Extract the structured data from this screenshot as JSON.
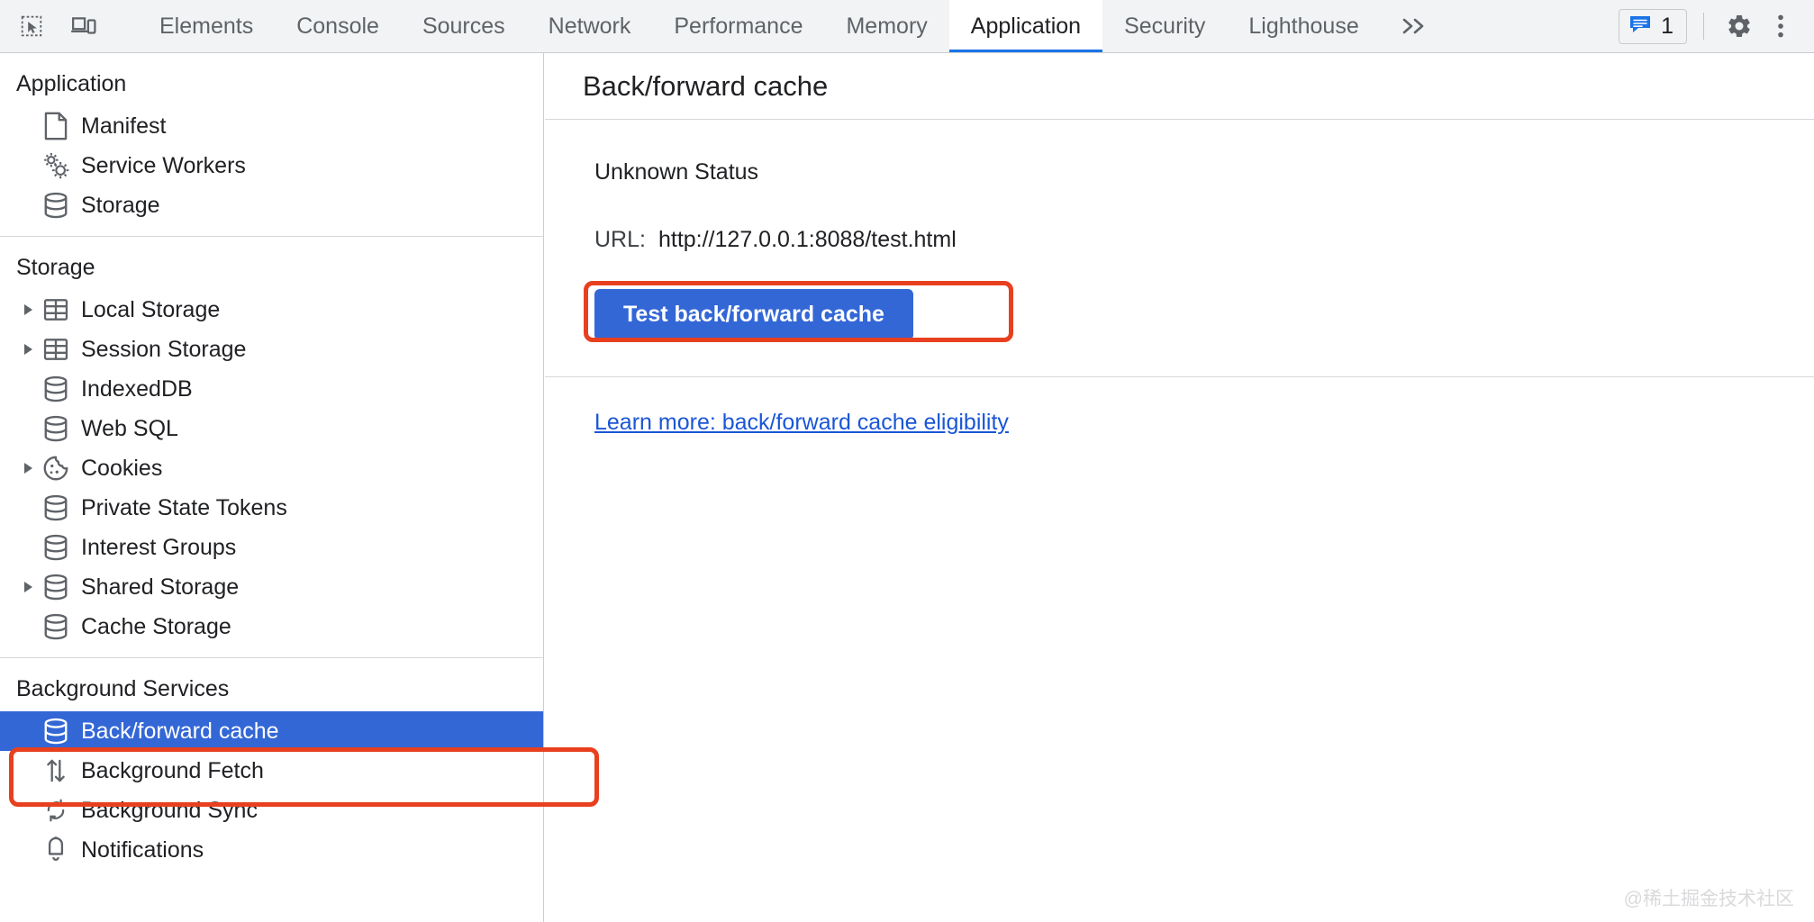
{
  "toolbar": {
    "inspect_icon": "inspect-element-icon",
    "device_icon": "device-toolbar-icon",
    "tabs": [
      {
        "label": "Elements",
        "active": false
      },
      {
        "label": "Console",
        "active": false
      },
      {
        "label": "Sources",
        "active": false
      },
      {
        "label": "Network",
        "active": false
      },
      {
        "label": "Performance",
        "active": false
      },
      {
        "label": "Memory",
        "active": false
      },
      {
        "label": "Application",
        "active": true
      },
      {
        "label": "Security",
        "active": false
      },
      {
        "label": "Lighthouse",
        "active": false
      }
    ],
    "more_tabs_icon": "chevron-double-right-icon",
    "message_badge": {
      "icon": "message-icon",
      "count": "1"
    },
    "settings_icon": "gear-icon",
    "more_options_icon": "kebab-menu-icon",
    "active_tab_color": "#1a73e8"
  },
  "sidebar": {
    "groups": [
      {
        "title": "Application",
        "items": [
          {
            "label": "Manifest",
            "icon": "document-icon",
            "expandable": false,
            "selected": false
          },
          {
            "label": "Service Workers",
            "icon": "gears-icon",
            "expandable": false,
            "selected": false
          },
          {
            "label": "Storage",
            "icon": "database-icon",
            "expandable": false,
            "selected": false
          }
        ]
      },
      {
        "title": "Storage",
        "items": [
          {
            "label": "Local Storage",
            "icon": "table-icon",
            "expandable": true,
            "selected": false
          },
          {
            "label": "Session Storage",
            "icon": "table-icon",
            "expandable": true,
            "selected": false
          },
          {
            "label": "IndexedDB",
            "icon": "database-icon",
            "expandable": false,
            "selected": false
          },
          {
            "label": "Web SQL",
            "icon": "database-icon",
            "expandable": false,
            "selected": false
          },
          {
            "label": "Cookies",
            "icon": "cookie-icon",
            "expandable": true,
            "selected": false
          },
          {
            "label": "Private State Tokens",
            "icon": "database-icon",
            "expandable": false,
            "selected": false
          },
          {
            "label": "Interest Groups",
            "icon": "database-icon",
            "expandable": false,
            "selected": false
          },
          {
            "label": "Shared Storage",
            "icon": "database-icon",
            "expandable": true,
            "selected": false
          },
          {
            "label": "Cache Storage",
            "icon": "database-icon",
            "expandable": false,
            "selected": false
          }
        ]
      },
      {
        "title": "Background Services",
        "items": [
          {
            "label": "Back/forward cache",
            "icon": "database-icon",
            "expandable": false,
            "selected": true
          },
          {
            "label": "Background Fetch",
            "icon": "arrows-up-down-icon",
            "expandable": false,
            "selected": false
          },
          {
            "label": "Background Sync",
            "icon": "sync-icon",
            "expandable": false,
            "selected": false
          },
          {
            "label": "Notifications",
            "icon": "bell-icon",
            "expandable": false,
            "selected": false
          }
        ]
      }
    ],
    "selected_bg_color": "#3367d6"
  },
  "main": {
    "panel_title": "Back/forward cache",
    "status": "Unknown Status",
    "url_label": "URL:",
    "url_value": "http://127.0.0.1:8088/test.html",
    "test_button_label": "Test back/forward cache",
    "test_button_color": "#3367d6",
    "learn_more_label": "Learn more: back/forward cache eligibility",
    "learn_more_color": "#1a56d6"
  },
  "annotations": {
    "color": "#e8401f",
    "button_highlight": "Test back/forward cache",
    "sidebar_highlight": "Back/forward cache"
  },
  "watermark": {
    "text": "@稀土掘金技术社区"
  }
}
